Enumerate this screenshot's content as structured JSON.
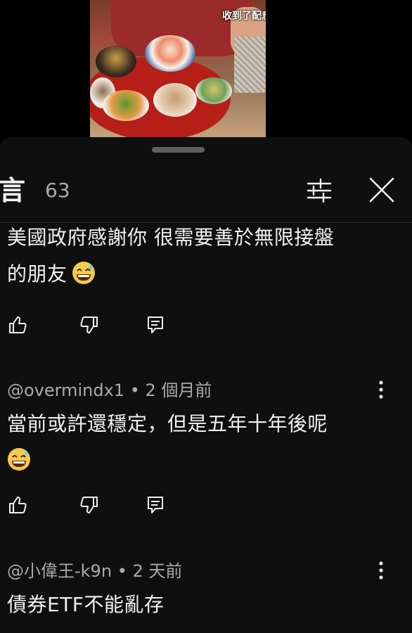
{
  "video": {
    "caption": "收到了配息通知"
  },
  "sheet": {
    "title": "言",
    "count": "63",
    "icons": {
      "filter": "filter-sliders-icon",
      "close": "close-icon",
      "drag": "drag-handle"
    }
  },
  "comments": [
    {
      "author": "",
      "age": "",
      "line1": "美國政府感謝你 很需要善於無限接盤",
      "line2": "的朋友",
      "emoji": "grinning-sweat-emoji"
    },
    {
      "author": "@overmindx1",
      "age": "2 個月前",
      "line1": "當前或許還穩定，但是五年十年後呢",
      "line2": "",
      "emoji": "grinning-sweat-emoji"
    },
    {
      "author": "@小偉王-k9n",
      "age": "2 天前",
      "line1": "債券ETF不能亂存",
      "line2": "",
      "emoji": ""
    }
  ],
  "actions": {
    "like": "thumbs-up-icon",
    "dislike": "thumbs-down-icon",
    "reply": "reply-icon",
    "more": "more-vertical-icon"
  },
  "colors": {
    "background": "#0f0f0f",
    "text": "#f1f1f1",
    "secondary_text": "#aaaaaa",
    "emoji_face": "#f7c948"
  }
}
